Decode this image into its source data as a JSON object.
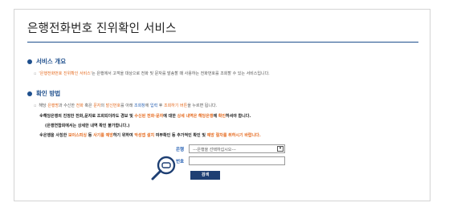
{
  "title": "은행전화번호 진위확인 서비스",
  "overview": {
    "heading": "서비스 개요",
    "line1_prefix": "'은행전화번호 진위확인 서비스'",
    "line1_rest": "는 은행에서 고객을 대상으로 전화 및 문자를 발송할 때 사용하는 전화번호를 조회할 수 있는 서비스입니다."
  },
  "method": {
    "heading": "확인 방법",
    "line1": {
      "a": "해당 ",
      "b": "은행명",
      "c": "과 수신한 ",
      "d": "전화",
      "e": " 혹은 ",
      "f": "문자",
      "g": "의 ",
      "h": "발신번호",
      "i": "를 아래 ",
      "j": "조회창",
      "k": "에 ",
      "l": "입력",
      "m": " 후 ",
      "n": "조회하기 버튼",
      "o": "을 누르면 됩니다."
    },
    "line2": {
      "a": "※해당은행의 진정한 전화,문자로 조회되더라도 경보 및 ",
      "b": "수신된 전화·문자",
      "c": "에 대한 ",
      "d": "상세 내역은 해당은행",
      "e": "에 ",
      "f": "확인",
      "g": "하셔야 합니다."
    },
    "line3": "(은행연합회에서는 상세한 내역 확인 불가합니다.)",
    "line4": {
      "a": "※은행을 사칭한 ",
      "b": "보이스피싱",
      "c": " 등 ",
      "d": "사기를 예방",
      "e": "하기 위하여 ",
      "f": "악성앱 설치",
      "g": " 여부확인 등 추가적인 확인 및 ",
      "h": "예방 절차를 취하시기 바랍니다."
    }
  },
  "form": {
    "bank_label": "은행",
    "bank_select_value": "---은행을 선택하십시오---",
    "number_label": "번호",
    "number_value": "",
    "search_button": "검색"
  },
  "colors": {
    "accent": "#1e4f8d",
    "link_blue": "#2a63b5",
    "highlight_orange": "#e56a1e",
    "button": "#1e3f73"
  },
  "icons": [
    "magnifier-icon",
    "dropdown-caret-icon",
    "section-bullet-icon"
  ]
}
